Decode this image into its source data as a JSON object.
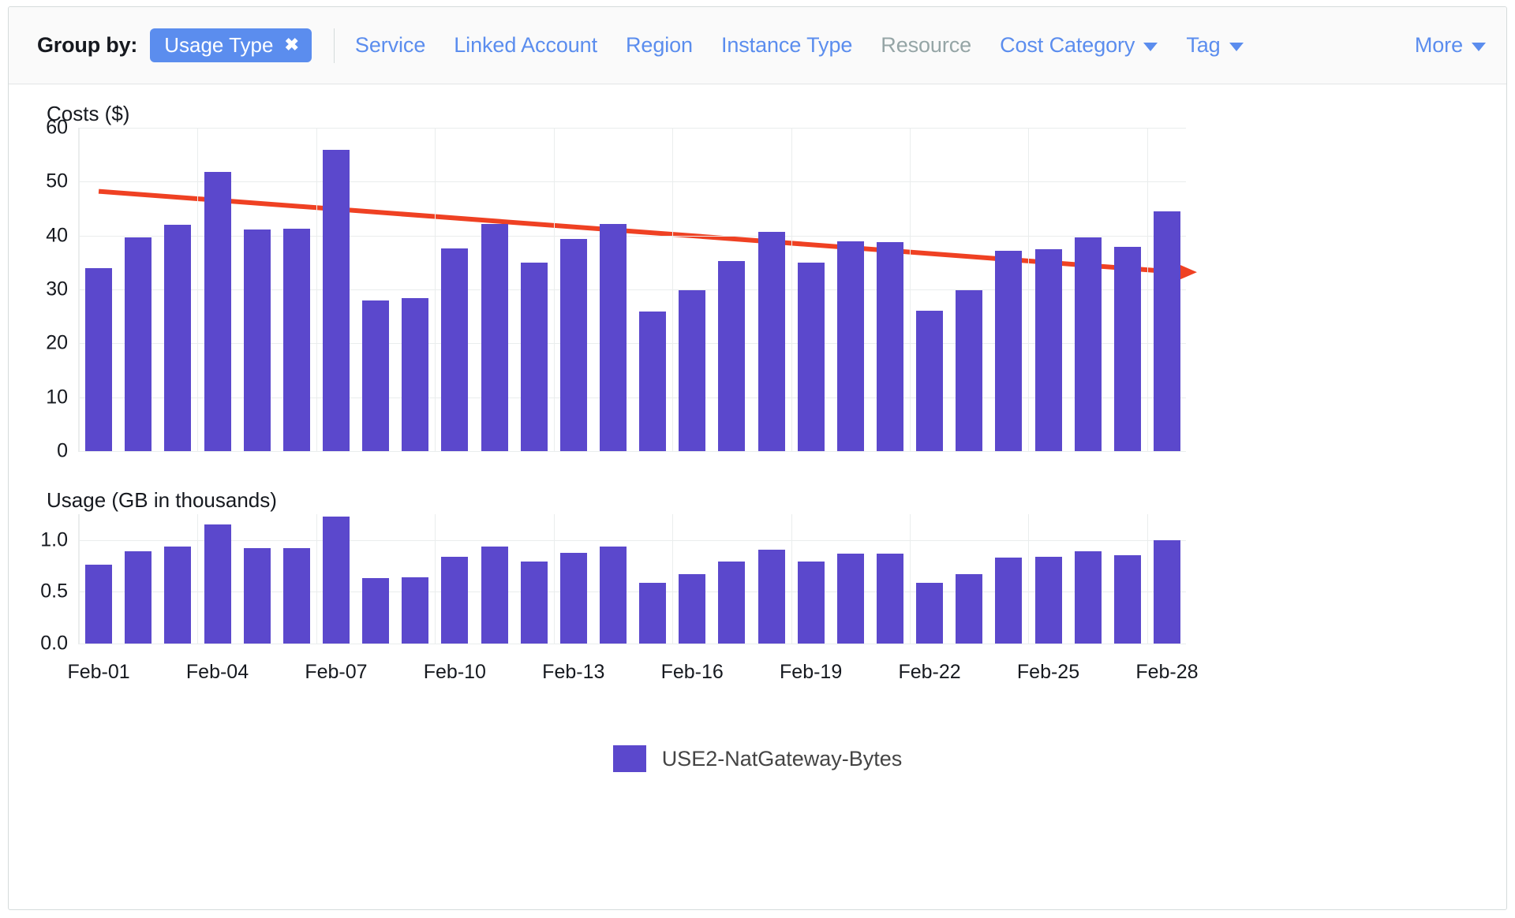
{
  "toolbar": {
    "group_by_label": "Group by:",
    "selected_chip": {
      "label": "Usage Type",
      "remove_icon": "✖"
    },
    "options": [
      {
        "id": "service",
        "label": "Service",
        "disabled": false,
        "has_caret": false
      },
      {
        "id": "linked-account",
        "label": "Linked Account",
        "disabled": false,
        "has_caret": false
      },
      {
        "id": "region",
        "label": "Region",
        "disabled": false,
        "has_caret": false
      },
      {
        "id": "instance-type",
        "label": "Instance Type",
        "disabled": false,
        "has_caret": false
      },
      {
        "id": "resource",
        "label": "Resource",
        "disabled": true,
        "has_caret": false
      },
      {
        "id": "cost-category",
        "label": "Cost Category",
        "disabled": false,
        "has_caret": true
      },
      {
        "id": "tag",
        "label": "Tag",
        "disabled": false,
        "has_caret": true
      }
    ],
    "more_label": "More"
  },
  "legend": [
    {
      "label": "USE2-NatGateway-Bytes",
      "color": "#5b48cc"
    }
  ],
  "colors": {
    "bar": "#5b48cc",
    "trend": "#ef4123",
    "link": "#5b8dee",
    "chip_bg": "#5b8dee",
    "disabled_text": "#95a5a6",
    "grid": "#eaeded"
  },
  "chart_data": [
    {
      "type": "bar",
      "id": "costs",
      "title": "Costs ($)",
      "ylabel": "Costs ($)",
      "xlabel": "",
      "ylim": [
        0,
        60
      ],
      "yticks": [
        0,
        10,
        20,
        30,
        40,
        50,
        60
      ],
      "ytick_labels": [
        "0",
        "10",
        "20",
        "30",
        "40",
        "50",
        "60"
      ],
      "grid": true,
      "legend_position": "bottom",
      "categories": [
        "Feb-01",
        "Feb-02",
        "Feb-03",
        "Feb-04",
        "Feb-05",
        "Feb-06",
        "Feb-07",
        "Feb-08",
        "Feb-09",
        "Feb-10",
        "Feb-11",
        "Feb-12",
        "Feb-13",
        "Feb-14",
        "Feb-15",
        "Feb-16",
        "Feb-17",
        "Feb-18",
        "Feb-19",
        "Feb-20",
        "Feb-21",
        "Feb-22",
        "Feb-23",
        "Feb-24",
        "Feb-25",
        "Feb-26",
        "Feb-27",
        "Feb-28"
      ],
      "xtick_labels": [
        "Feb-01",
        "Feb-04",
        "Feb-07",
        "Feb-10",
        "Feb-13",
        "Feb-16",
        "Feb-19",
        "Feb-22",
        "Feb-25",
        "Feb-28"
      ],
      "series": [
        {
          "name": "USE2-NatGateway-Bytes",
          "color": "#5b48cc",
          "values": [
            34.0,
            39.7,
            42.0,
            51.8,
            41.1,
            41.3,
            55.9,
            28.0,
            28.4,
            37.6,
            42.1,
            35.0,
            39.4,
            42.1,
            25.9,
            29.9,
            35.3,
            40.7,
            35.0,
            38.9,
            38.8,
            26.0,
            29.8,
            37.2,
            37.5,
            39.6,
            37.9,
            44.5
          ]
        }
      ],
      "annotations": [
        {
          "type": "trend-arrow",
          "color": "#ef4123",
          "start": {
            "x_category": "Feb-01",
            "y": 48.2
          },
          "end": {
            "x_category": "Feb-28",
            "y": 33.2
          },
          "arrowhead": "right"
        }
      ]
    },
    {
      "type": "bar",
      "id": "usage",
      "title": "Usage (GB in thousands)",
      "ylabel": "Usage (GB in thousands)",
      "xlabel": "",
      "ylim": [
        0,
        1.25
      ],
      "yticks": [
        0.0,
        0.5,
        1.0
      ],
      "ytick_labels": [
        "0.0",
        "0.5",
        "1.0"
      ],
      "grid": true,
      "categories": [
        "Feb-01",
        "Feb-02",
        "Feb-03",
        "Feb-04",
        "Feb-05",
        "Feb-06",
        "Feb-07",
        "Feb-08",
        "Feb-09",
        "Feb-10",
        "Feb-11",
        "Feb-12",
        "Feb-13",
        "Feb-14",
        "Feb-15",
        "Feb-16",
        "Feb-17",
        "Feb-18",
        "Feb-19",
        "Feb-20",
        "Feb-21",
        "Feb-22",
        "Feb-23",
        "Feb-24",
        "Feb-25",
        "Feb-26",
        "Feb-27",
        "Feb-28"
      ],
      "xtick_labels": [
        "Feb-01",
        "Feb-04",
        "Feb-07",
        "Feb-10",
        "Feb-13",
        "Feb-16",
        "Feb-19",
        "Feb-22",
        "Feb-25",
        "Feb-28"
      ],
      "series": [
        {
          "name": "USE2-NatGateway-Bytes",
          "color": "#5b48cc",
          "values": [
            0.76,
            0.89,
            0.94,
            1.15,
            0.92,
            0.92,
            1.23,
            0.63,
            0.64,
            0.84,
            0.94,
            0.79,
            0.88,
            0.94,
            0.59,
            0.67,
            0.79,
            0.91,
            0.79,
            0.87,
            0.87,
            0.59,
            0.67,
            0.83,
            0.84,
            0.89,
            0.85,
            1.0
          ]
        }
      ]
    }
  ]
}
